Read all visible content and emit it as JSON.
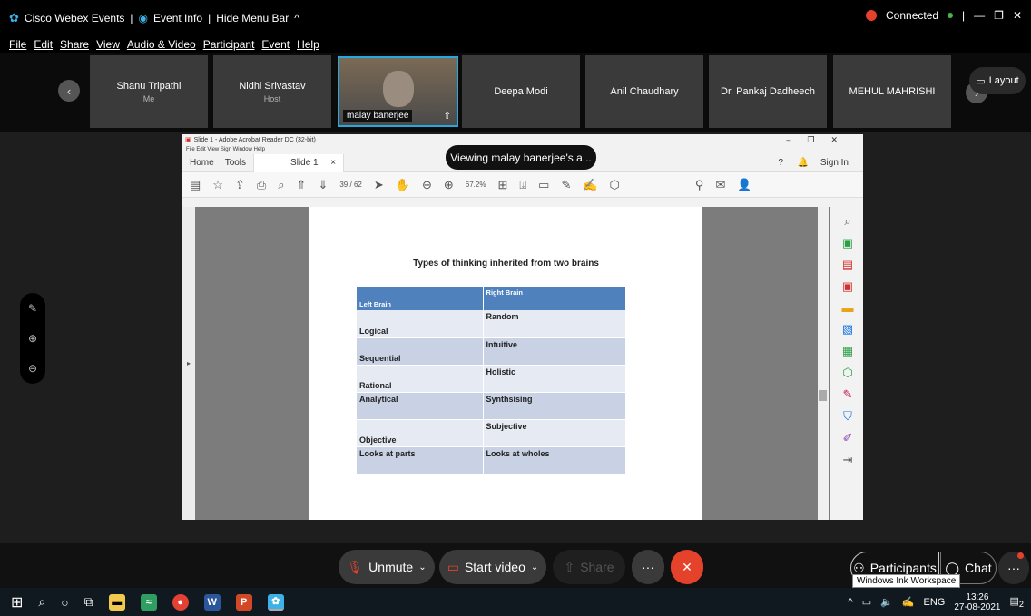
{
  "titlebar": {
    "app": "Cisco Webex Events",
    "event_info": "Event Info",
    "hide": "Hide Menu Bar",
    "connected": "Connected"
  },
  "menu": [
    "File",
    "Edit",
    "Share",
    "View",
    "Audio & Video",
    "Participant",
    "Event",
    "Help"
  ],
  "participants": [
    {
      "name": "Shanu Tripathi",
      "role": "Me"
    },
    {
      "name": "Nidhi Srivastav",
      "role": "Host"
    },
    {
      "name": "malay banerjee",
      "role": ""
    },
    {
      "name": "Deepa Modi",
      "role": ""
    },
    {
      "name": "Anil Chaudhary",
      "role": ""
    },
    {
      "name": "Dr. Pankaj Dadheech",
      "role": ""
    },
    {
      "name": "MEHUL MAHRISHI",
      "role": ""
    }
  ],
  "layout_label": "Layout",
  "viewing": "Viewing malay banerjee's a...",
  "acrobat": {
    "title": "Slide 1 - Adobe Acrobat Reader DC (32-bit)",
    "menu": "File  Edit  View  Sign  Window  Help",
    "tab_home": "Home",
    "tab_tools": "Tools",
    "tab_doc": "Slide 1",
    "sign_in": "Sign In",
    "page": "39",
    "pages": "/ 62",
    "zoom": "67.2%"
  },
  "slide": {
    "title": "Types of thinking inherited from two brains",
    "headers": [
      "Left Brain",
      "Right Brain"
    ],
    "rows": [
      [
        "Logical",
        "Random"
      ],
      [
        "Sequential",
        "Intuitive"
      ],
      [
        "Rational",
        "Holistic"
      ],
      [
        "Analytical",
        "Synthsising"
      ],
      [
        "Objective",
        "Subjective"
      ],
      [
        "Looks at parts",
        "Looks at wholes"
      ]
    ]
  },
  "controls": {
    "unmute": "Unmute",
    "video": "Start video",
    "share": "Share",
    "participants": "Participants",
    "chat": "Chat"
  },
  "taskbar": {
    "lang": "ENG",
    "time": "13:26",
    "date": "27-08-2021",
    "notif": "2",
    "tooltip": "Windows Ink Workspace"
  }
}
